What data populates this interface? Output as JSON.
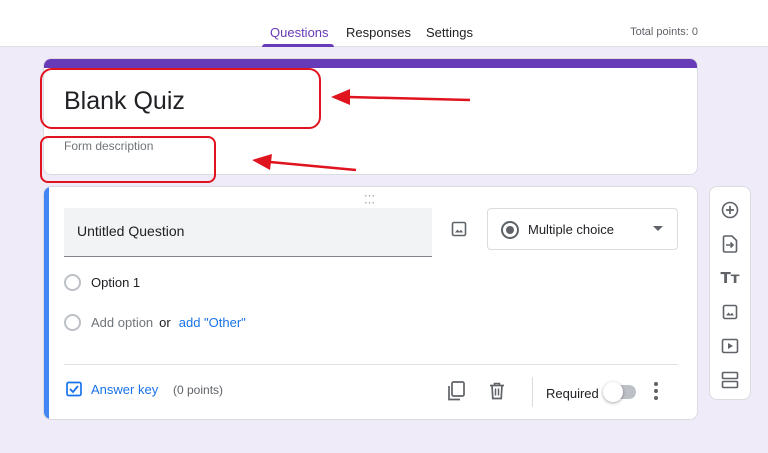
{
  "tabs": [
    {
      "label": "Questions",
      "active": true
    },
    {
      "label": "Responses",
      "active": false
    },
    {
      "label": "Settings",
      "active": false
    }
  ],
  "total_points": "Total points: 0",
  "form": {
    "title": "Blank Quiz",
    "description_placeholder": "Form description"
  },
  "question": {
    "title": "Untitled Question",
    "type": "Multiple choice",
    "options": [
      "Option 1"
    ],
    "add_option": "Add option",
    "or_text": "or",
    "add_other": "add \"Other\"",
    "answer_key": "Answer key",
    "points": "(0 points)",
    "required_label": "Required",
    "required": false
  },
  "toolbar": {
    "icons": [
      "add-question-icon",
      "import-questions-icon",
      "add-title-icon",
      "add-image-icon",
      "add-video-icon",
      "add-section-icon"
    ]
  },
  "colors": {
    "accent": "#673ab7",
    "active_question": "#4285f4",
    "link": "#1a73e8",
    "annotation": "#e0141e",
    "background": "#f0ebf8"
  }
}
